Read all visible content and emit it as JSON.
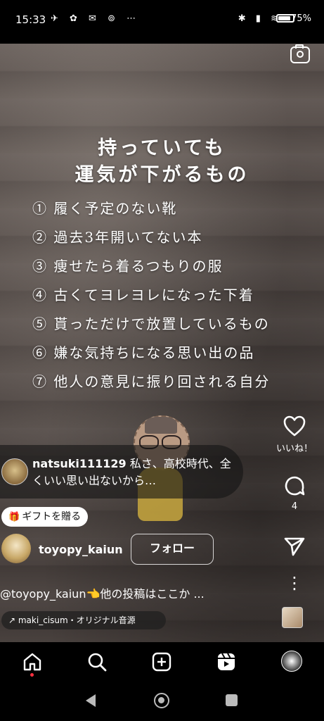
{
  "status_bar": {
    "time": "15:33",
    "left_icons": "✈ ✿ ✉ ⊚ ⋯",
    "right_icons": "✱ ▮ ≋",
    "battery": "75%"
  },
  "reel": {
    "title_line1": "持っていても",
    "title_line2": "運気が下がるもの",
    "items": [
      "① 履く予定のない靴",
      "② 過去3年開いてない本",
      "③ 痩せたら着るつもりの服",
      "④ 古くてヨレヨレになった下着",
      "⑤ 貰っただけで放置しているもの",
      "⑥ 嫌な気持ちになる思い出の品",
      "⑦ 他人の意見に振り回される自分"
    ]
  },
  "comment": {
    "user": "natsuki111129",
    "text": " 私さ、高校時代、全くいい思い出ないから…"
  },
  "gift": {
    "label": "ギフトを贈る"
  },
  "author": {
    "name": "toyopy_kaiun",
    "follow_label": "フォロー"
  },
  "caption": "@toyopy_kaiun👈他の投稿はここか ...",
  "audio": {
    "label": "↗ maki_cisum・オリジナル音源"
  },
  "side_actions": {
    "like_label": "いいね！",
    "comment_count": "4",
    "more_glyph": "⋮"
  },
  "icons": {
    "camera": "camera-icon",
    "heart": "heart-icon",
    "comment": "comment-icon",
    "share": "send-icon",
    "home": "home-icon",
    "search": "search-icon",
    "create": "plus-square-icon",
    "reels": "reels-icon"
  },
  "colors": {
    "accent_dot": "#ff3040",
    "follow_border": "#ffffff"
  }
}
